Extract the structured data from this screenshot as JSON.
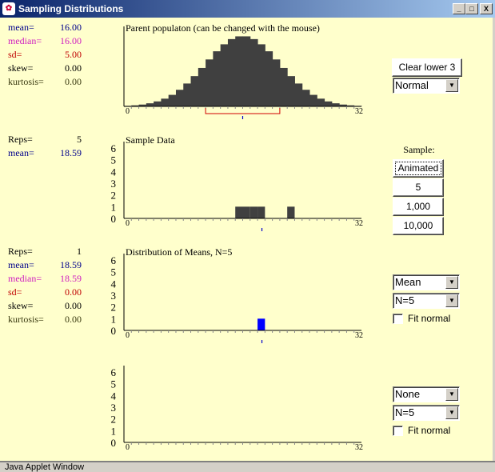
{
  "window": {
    "title": "Sampling Distributions",
    "icon": "java-applet-icon",
    "minimize": "_",
    "maximize": "□",
    "close": "X"
  },
  "parent_stats": [
    {
      "label": "mean=",
      "value": "16.00",
      "color": "#00008b"
    },
    {
      "label": "median=",
      "value": "16.00",
      "color": "#d020c0"
    },
    {
      "label": "sd=",
      "value": "5.00",
      "color": "#c00000"
    },
    {
      "label": "skew=",
      "value": "0.00",
      "color": "#000000"
    },
    {
      "label": "kurtosis=",
      "value": "0.00",
      "color": "#3a3a10"
    }
  ],
  "sample_stats": [
    {
      "label": "Reps=",
      "value": "5",
      "color": "#000000"
    },
    {
      "label": "mean=",
      "value": "18.59",
      "color": "#00008b"
    }
  ],
  "means_stats": [
    {
      "label": "Reps=",
      "value": "1",
      "color": "#000000"
    },
    {
      "label": "mean=",
      "value": "18.59",
      "color": "#00008b"
    },
    {
      "label": "median=",
      "value": "18.59",
      "color": "#d020c0"
    },
    {
      "label": "sd=",
      "value": "0.00",
      "color": "#c00000"
    },
    {
      "label": "skew=",
      "value": "0.00",
      "color": "#000000"
    },
    {
      "label": "kurtosis=",
      "value": "0.00",
      "color": "#3a3a10"
    }
  ],
  "chart_data": [
    {
      "type": "bar",
      "title": "Parent populaton (can be changed with the mouse)",
      "xlim": [
        0,
        32
      ],
      "x_tick_labels": [
        "0",
        "32"
      ],
      "bar_color": "#404040",
      "values": [
        0.008,
        0.015,
        0.026,
        0.044,
        0.071,
        0.11,
        0.164,
        0.236,
        0.325,
        0.43,
        0.546,
        0.667,
        0.783,
        0.882,
        0.956,
        0.995,
        0.995,
        0.956,
        0.882,
        0.783,
        0.667,
        0.546,
        0.43,
        0.325,
        0.236,
        0.164,
        0.11,
        0.071,
        0.044,
        0.026,
        0.015,
        0.008
      ],
      "mean_marker": 16,
      "sd_bracket": [
        11,
        21
      ]
    },
    {
      "type": "bar",
      "title": "Sample Data",
      "xlim": [
        0,
        32
      ],
      "ylim": [
        0,
        6
      ],
      "y_tick_labels": [
        "0",
        "1",
        "2",
        "3",
        "4",
        "5",
        "6"
      ],
      "x_tick_labels": [
        "0",
        "32"
      ],
      "bar_color": "#404040",
      "bins": [
        15,
        16,
        17,
        18,
        22
      ],
      "counts": [
        1,
        1,
        1,
        1,
        1
      ],
      "mean_marker": 18.59
    },
    {
      "type": "bar",
      "title": "Distribution of Means, N=5",
      "xlim": [
        0,
        32
      ],
      "ylim": [
        0,
        6
      ],
      "y_tick_labels": [
        "0",
        "1",
        "2",
        "3",
        "4",
        "5",
        "6"
      ],
      "x_tick_labels": [
        "0",
        "32"
      ],
      "bar_color": "#0000ff",
      "bins": [
        18
      ],
      "counts": [
        1
      ],
      "mean_marker": 18.59
    },
    {
      "type": "bar",
      "title": "",
      "xlim": [
        0,
        32
      ],
      "ylim": [
        0,
        6
      ],
      "y_tick_labels": [
        "0",
        "1",
        "2",
        "3",
        "4",
        "5",
        "6"
      ],
      "x_tick_labels": [
        "0",
        "32"
      ],
      "bins": [],
      "counts": []
    }
  ],
  "controls": {
    "clear_label": "Clear lower 3",
    "population_select": "Normal",
    "sample_label": "Sample:",
    "sample_buttons": [
      "Animated",
      "5",
      "1,000",
      "10,000"
    ],
    "stat3_select": "Mean",
    "n3_select": "N=5",
    "fit3_label": "Fit normal",
    "fit3_checked": false,
    "stat4_select": "None",
    "n4_select": "N=5",
    "fit4_label": "Fit normal",
    "fit4_checked": false
  },
  "status": "Java Applet Window"
}
